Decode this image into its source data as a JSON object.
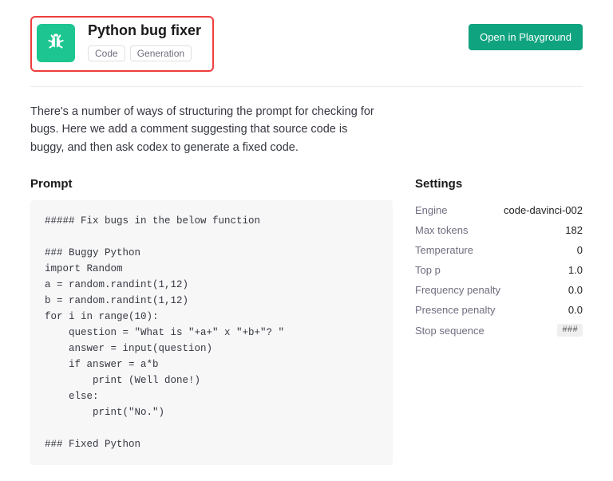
{
  "header": {
    "title": "Python bug fixer",
    "tags": [
      "Code",
      "Generation"
    ],
    "open_button": "Open in Playground",
    "icon_name": "bug-icon",
    "icon_bg": "#1dc690"
  },
  "description": "There's a number of ways of structuring the prompt for checking for bugs. Here we add a comment suggesting that source code is buggy, and then ask codex to generate a fixed code.",
  "prompt": {
    "heading": "Prompt",
    "content": "##### Fix bugs in the below function\n\n### Buggy Python\nimport Random\na = random.randint(1,12)\nb = random.randint(1,12)\nfor i in range(10):\n    question = \"What is \"+a+\" x \"+b+\"? \"\n    answer = input(question)\n    if answer = a*b\n        print (Well done!)\n    else:\n        print(\"No.\")\n\n### Fixed Python"
  },
  "settings": {
    "heading": "Settings",
    "rows": [
      {
        "label": "Engine",
        "value": "code-davinci-002"
      },
      {
        "label": "Max tokens",
        "value": "182"
      },
      {
        "label": "Temperature",
        "value": "0"
      },
      {
        "label": "Top p",
        "value": "1.0"
      },
      {
        "label": "Frequency penalty",
        "value": "0.0"
      },
      {
        "label": "Presence penalty",
        "value": "0.0"
      },
      {
        "label": "Stop sequence",
        "value": "###",
        "chip": true
      }
    ]
  }
}
